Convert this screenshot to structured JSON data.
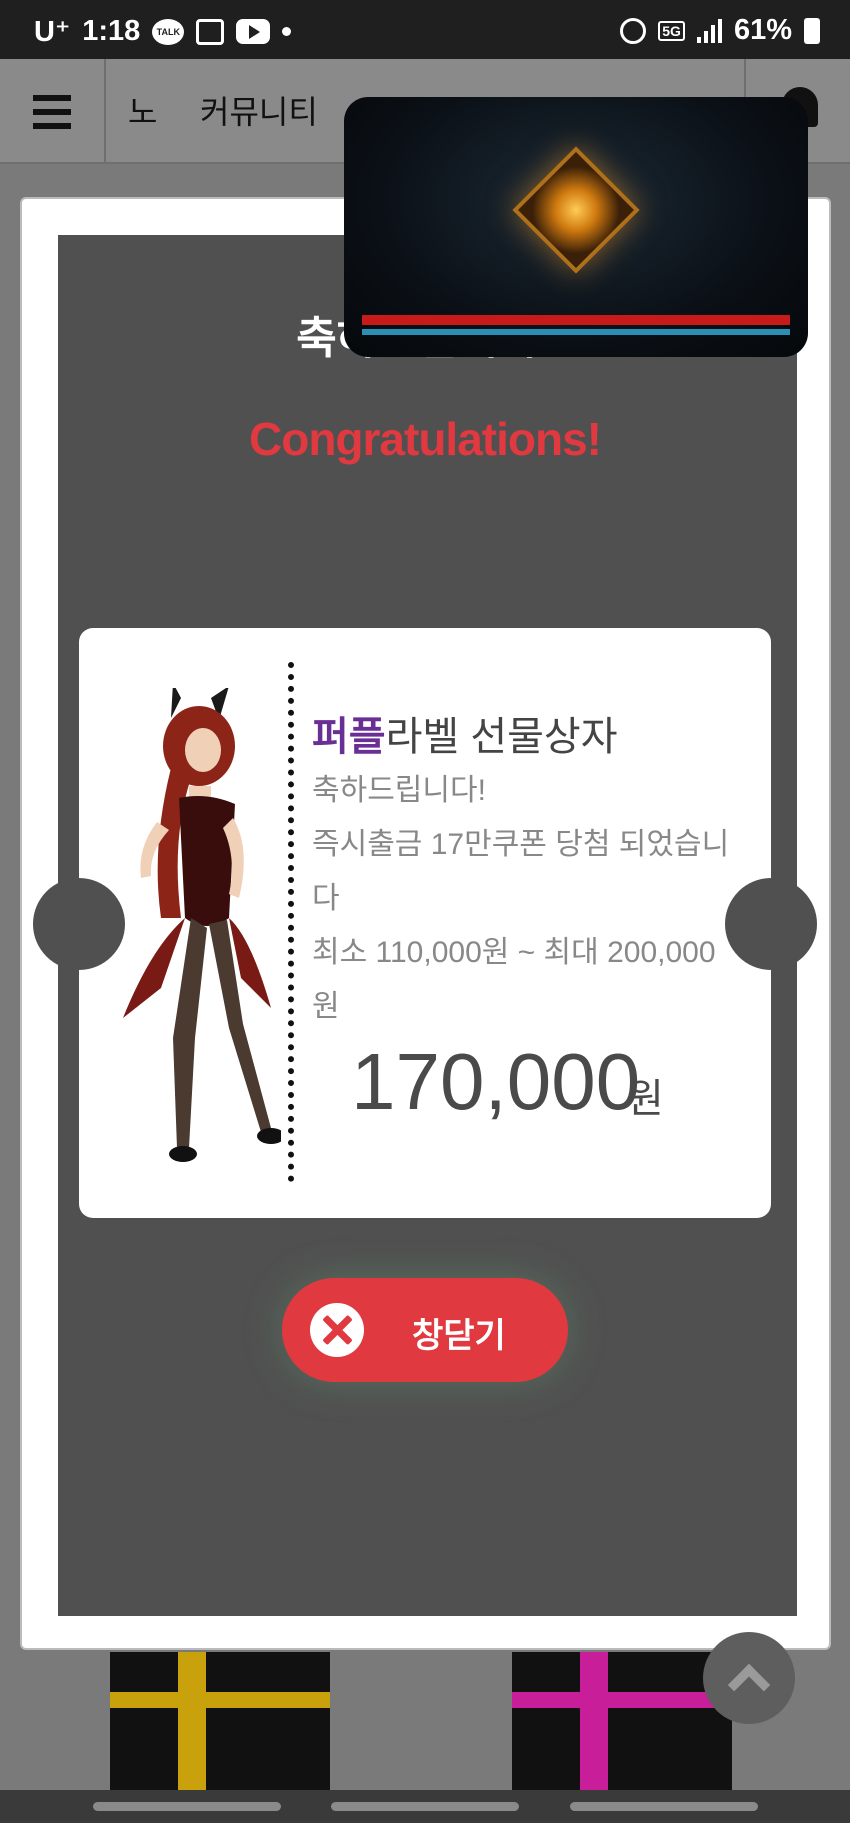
{
  "status_bar": {
    "carrier": "U⁺",
    "time": "1:18",
    "network": "5G",
    "battery": "61%",
    "icons": [
      "kakaotalk-icon",
      "gallery-icon",
      "youtube-icon",
      "alarm-icon",
      "signal-icon",
      "battery-icon"
    ]
  },
  "header": {
    "nav_items": [
      "노",
      "커뮤니티"
    ]
  },
  "modal": {
    "title_ko": "축하드립니다!",
    "title_en": "Congratulations!",
    "ticket": {
      "title_highlight": "퍼플",
      "title_rest": "라벨 선물상자",
      "line1": "축하드립니다!",
      "line2": "즉시출금 17만쿠폰 당첨 되었습니다",
      "line3": "최소 110,000원 ~ 최대 200,000원",
      "amount": "170,000",
      "amount_unit": "원"
    },
    "close_label": "창닫기"
  },
  "colors": {
    "accent_red": "#e0393f",
    "highlight_purple": "#6a2f94",
    "modal_bg": "#505050"
  }
}
